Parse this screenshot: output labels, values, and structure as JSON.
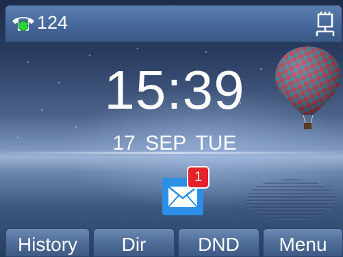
{
  "statusbar": {
    "account": "124",
    "line_icon": "phone-handset-icon",
    "network_icon": "wired-network-icon"
  },
  "idle": {
    "time": "15:39",
    "date": "17 SEP TUE"
  },
  "notifications": {
    "message_icon": "envelope-icon",
    "unread_count": "1"
  },
  "softkeys": [
    "History",
    "Dir",
    "DND",
    "Menu"
  ],
  "colors": {
    "statusbar": "#46679a",
    "softkey": "#4f6d98",
    "message_icon": "#2b8fe7",
    "badge": "#e3222a",
    "line_status": "#2bd23a"
  }
}
